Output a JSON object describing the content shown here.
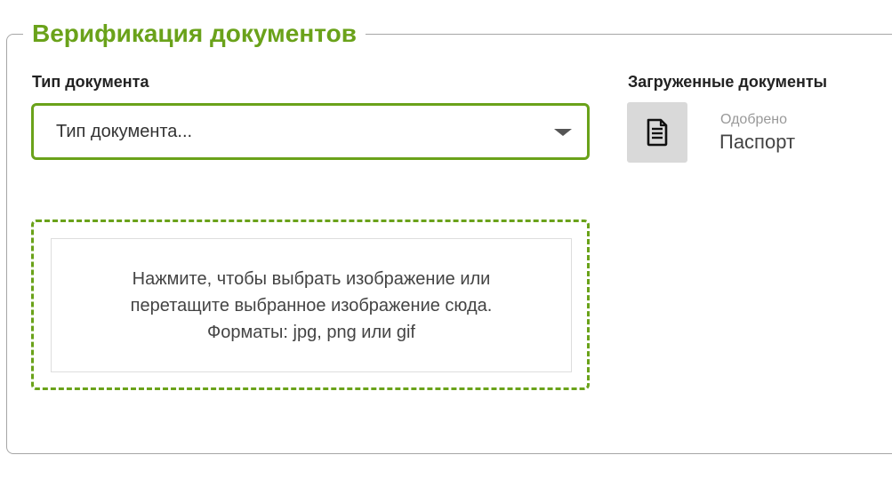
{
  "section": {
    "title": "Верификация документов"
  },
  "form": {
    "doc_type_label": "Тип документа",
    "doc_type_select": {
      "value": "Тип документа..."
    },
    "dropzone": {
      "lines": [
        "Нажмите, чтобы выбрать изображение или",
        "перетащите выбранное изображение сюда.",
        "Форматы: jpg, png или gif"
      ]
    }
  },
  "uploaded": {
    "label": "Загруженные документы",
    "items": [
      {
        "status": "Одобрено",
        "name": "Паспорт",
        "icon": "document-icon"
      }
    ]
  },
  "colors": {
    "accent": "#6aa21a",
    "border": "#a6a6a6",
    "thumb_bg": "#d9d9d9"
  }
}
